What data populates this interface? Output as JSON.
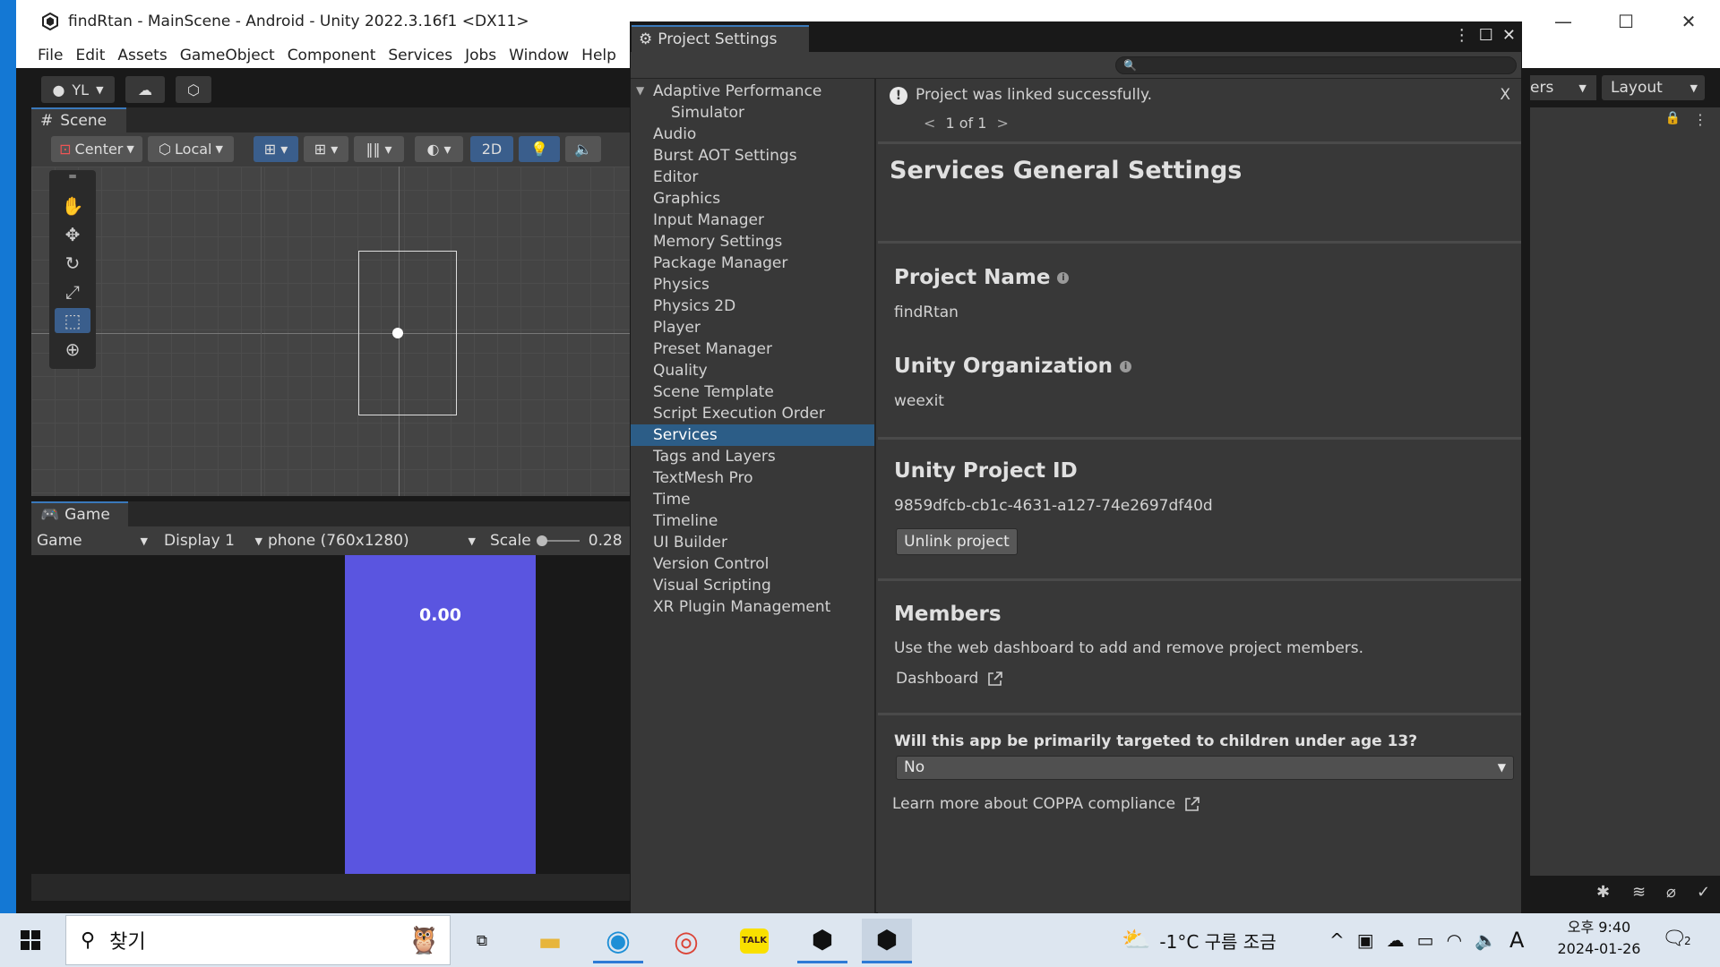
{
  "window": {
    "title": "findRtan - MainScene - Android - Unity 2022.3.16f1 <DX11>",
    "minimize": "—",
    "maximize": "☐",
    "close": "✕"
  },
  "menu": [
    "File",
    "Edit",
    "Assets",
    "GameObject",
    "Component",
    "Services",
    "Jobs",
    "Window",
    "Help"
  ],
  "toolbar": {
    "account": "YL",
    "layers_partial": "ers",
    "layout": "Layout"
  },
  "scene": {
    "tab": "Scene",
    "pivot": "Center",
    "space": "Local",
    "mode_2d": "2D"
  },
  "game": {
    "tab": "Game",
    "mode": "Game",
    "display": "Display 1",
    "resolution": "phone (760x1280)",
    "scale_label": "Scale",
    "scale_value": "0.28",
    "score": "0.00"
  },
  "project_settings": {
    "title": "Project Settings",
    "sidebar": [
      "Adaptive Performance",
      "Simulator",
      "Audio",
      "Burst AOT Settings",
      "Editor",
      "Graphics",
      "Input Manager",
      "Memory Settings",
      "Package Manager",
      "Physics",
      "Physics 2D",
      "Player",
      "Preset Manager",
      "Quality",
      "Scene Template",
      "Script Execution Order",
      "Services",
      "Tags and Layers",
      "TextMesh Pro",
      "Time",
      "Timeline",
      "UI Builder",
      "Version Control",
      "Visual Scripting",
      "XR Plugin Management"
    ],
    "selected": "Services",
    "notification": {
      "text": "Project was linked successfully.",
      "close": "X",
      "prev": "<",
      "pager": "1 of 1",
      "next": ">"
    },
    "header": "Services General Settings",
    "project_name_label": "Project Name",
    "project_name": "findRtan",
    "org_label": "Unity Organization",
    "org": "weexit",
    "project_id_label": "Unity Project ID",
    "project_id": "9859dfcb-cb1c-4631-a127-74e2697df40d",
    "unlink": "Unlink project",
    "members_label": "Members",
    "members_desc": "Use the web dashboard to add and remove project members.",
    "dashboard": "Dashboard",
    "coppa_question": "Will this app be primarily targeted to children under age 13?",
    "coppa_value": "No",
    "coppa_link": "Learn more about COPPA compliance"
  },
  "taskbar": {
    "search_text": "찾기",
    "weather": "-1°C  구름 조금",
    "ime": "A",
    "time": "오후 9:40",
    "date": "2024-01-26",
    "notification_count": "2"
  },
  "colors": {
    "unity_bg": "#383838",
    "selection": "#2c5d87",
    "game_phone": "#5a55e0",
    "desktop": "#1e6fc0"
  }
}
